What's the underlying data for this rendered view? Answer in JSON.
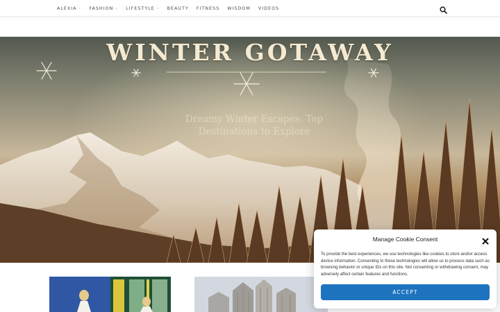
{
  "nav": {
    "items": [
      {
        "label": "ALEXIA",
        "has_dropdown": true
      },
      {
        "label": "FASHION",
        "has_dropdown": true
      },
      {
        "label": "LIFESTYLE",
        "has_dropdown": true
      },
      {
        "label": "BEAUTY",
        "has_dropdown": false
      },
      {
        "label": "FITNESS",
        "has_dropdown": false
      },
      {
        "label": "WISDOM",
        "has_dropdown": false
      },
      {
        "label": "VIDEOS",
        "has_dropdown": false
      }
    ],
    "dropdown_glyph": "⌵",
    "search_icon": "search-icon"
  },
  "hero": {
    "image_title": "WINTER GOTAWAY",
    "post_title": "Dreamy Winter Escapes: Top Destinations to Explore"
  },
  "cookie_banner": {
    "title": "Manage Cookie Consent",
    "body": "To provide the best experiences, we use technologies like cookies to store and/or access device information. Consenting to these technologies will allow us to process data such as browsing behavior or unique IDs on this site. Not consenting or withdrawing consent, may adversely affect certain features and functions.",
    "accept_label": "ACCEPT",
    "close_icon": "close-icon",
    "accent_color": "#1e73be"
  }
}
